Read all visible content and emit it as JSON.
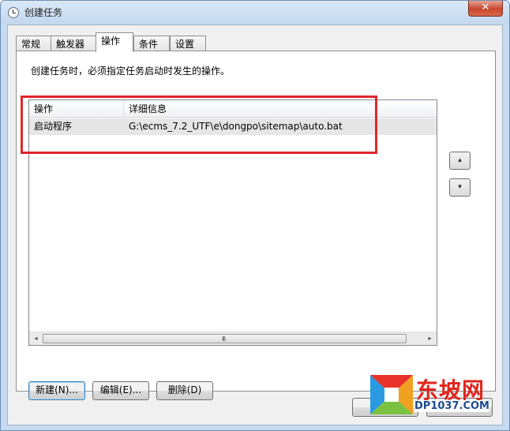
{
  "window": {
    "title": "创建任务",
    "close_symbol": "✕"
  },
  "tabs": [
    {
      "label": "常规",
      "active": false
    },
    {
      "label": "触发器",
      "active": false
    },
    {
      "label": "操作",
      "active": true
    },
    {
      "label": "条件",
      "active": false
    },
    {
      "label": "设置",
      "active": false
    }
  ],
  "panel": {
    "description": "创建任务时，必须指定任务启动时发生的操作。",
    "list": {
      "columns": [
        "操作",
        "详细信息"
      ],
      "rows": [
        {
          "action": "启动程序",
          "details": "G:\\ecms_7.2_UTF\\e\\dongpo\\sitemap\\auto.bat"
        }
      ]
    },
    "scroll": {
      "left": "◂",
      "right": "▸",
      "grip": "III"
    },
    "move_up": "▴",
    "move_down": "▾",
    "buttons": {
      "new": "新建(N)...",
      "edit": "编辑(E)...",
      "delete": "删除(D)"
    }
  },
  "watermark": {
    "cn": "东坡网",
    "en": "DP1037.COM"
  },
  "colors": {
    "highlight": "#e0262c",
    "titlebar": "#c7dbf0"
  }
}
